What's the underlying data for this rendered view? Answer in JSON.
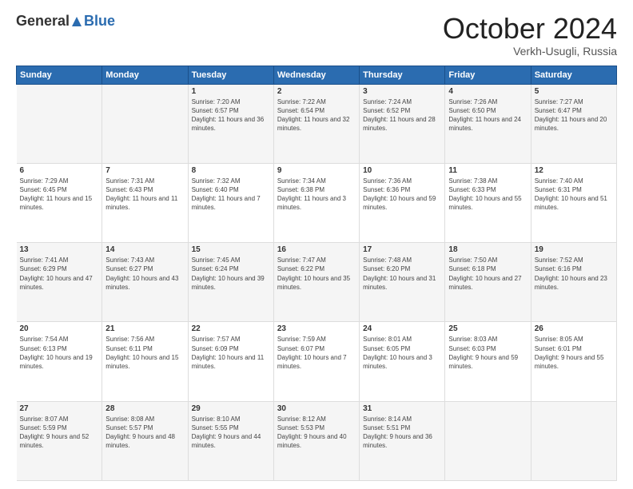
{
  "header": {
    "logo_general": "General",
    "logo_blue": "Blue",
    "month_title": "October 2024",
    "location": "Verkh-Usugli, Russia"
  },
  "days_of_week": [
    "Sunday",
    "Monday",
    "Tuesday",
    "Wednesday",
    "Thursday",
    "Friday",
    "Saturday"
  ],
  "weeks": [
    [
      {
        "day": "",
        "info": ""
      },
      {
        "day": "",
        "info": ""
      },
      {
        "day": "1",
        "info": "Sunrise: 7:20 AM\nSunset: 6:57 PM\nDaylight: 11 hours and 36 minutes."
      },
      {
        "day": "2",
        "info": "Sunrise: 7:22 AM\nSunset: 6:54 PM\nDaylight: 11 hours and 32 minutes."
      },
      {
        "day": "3",
        "info": "Sunrise: 7:24 AM\nSunset: 6:52 PM\nDaylight: 11 hours and 28 minutes."
      },
      {
        "day": "4",
        "info": "Sunrise: 7:26 AM\nSunset: 6:50 PM\nDaylight: 11 hours and 24 minutes."
      },
      {
        "day": "5",
        "info": "Sunrise: 7:27 AM\nSunset: 6:47 PM\nDaylight: 11 hours and 20 minutes."
      }
    ],
    [
      {
        "day": "6",
        "info": "Sunrise: 7:29 AM\nSunset: 6:45 PM\nDaylight: 11 hours and 15 minutes."
      },
      {
        "day": "7",
        "info": "Sunrise: 7:31 AM\nSunset: 6:43 PM\nDaylight: 11 hours and 11 minutes."
      },
      {
        "day": "8",
        "info": "Sunrise: 7:32 AM\nSunset: 6:40 PM\nDaylight: 11 hours and 7 minutes."
      },
      {
        "day": "9",
        "info": "Sunrise: 7:34 AM\nSunset: 6:38 PM\nDaylight: 11 hours and 3 minutes."
      },
      {
        "day": "10",
        "info": "Sunrise: 7:36 AM\nSunset: 6:36 PM\nDaylight: 10 hours and 59 minutes."
      },
      {
        "day": "11",
        "info": "Sunrise: 7:38 AM\nSunset: 6:33 PM\nDaylight: 10 hours and 55 minutes."
      },
      {
        "day": "12",
        "info": "Sunrise: 7:40 AM\nSunset: 6:31 PM\nDaylight: 10 hours and 51 minutes."
      }
    ],
    [
      {
        "day": "13",
        "info": "Sunrise: 7:41 AM\nSunset: 6:29 PM\nDaylight: 10 hours and 47 minutes."
      },
      {
        "day": "14",
        "info": "Sunrise: 7:43 AM\nSunset: 6:27 PM\nDaylight: 10 hours and 43 minutes."
      },
      {
        "day": "15",
        "info": "Sunrise: 7:45 AM\nSunset: 6:24 PM\nDaylight: 10 hours and 39 minutes."
      },
      {
        "day": "16",
        "info": "Sunrise: 7:47 AM\nSunset: 6:22 PM\nDaylight: 10 hours and 35 minutes."
      },
      {
        "day": "17",
        "info": "Sunrise: 7:48 AM\nSunset: 6:20 PM\nDaylight: 10 hours and 31 minutes."
      },
      {
        "day": "18",
        "info": "Sunrise: 7:50 AM\nSunset: 6:18 PM\nDaylight: 10 hours and 27 minutes."
      },
      {
        "day": "19",
        "info": "Sunrise: 7:52 AM\nSunset: 6:16 PM\nDaylight: 10 hours and 23 minutes."
      }
    ],
    [
      {
        "day": "20",
        "info": "Sunrise: 7:54 AM\nSunset: 6:13 PM\nDaylight: 10 hours and 19 minutes."
      },
      {
        "day": "21",
        "info": "Sunrise: 7:56 AM\nSunset: 6:11 PM\nDaylight: 10 hours and 15 minutes."
      },
      {
        "day": "22",
        "info": "Sunrise: 7:57 AM\nSunset: 6:09 PM\nDaylight: 10 hours and 11 minutes."
      },
      {
        "day": "23",
        "info": "Sunrise: 7:59 AM\nSunset: 6:07 PM\nDaylight: 10 hours and 7 minutes."
      },
      {
        "day": "24",
        "info": "Sunrise: 8:01 AM\nSunset: 6:05 PM\nDaylight: 10 hours and 3 minutes."
      },
      {
        "day": "25",
        "info": "Sunrise: 8:03 AM\nSunset: 6:03 PM\nDaylight: 9 hours and 59 minutes."
      },
      {
        "day": "26",
        "info": "Sunrise: 8:05 AM\nSunset: 6:01 PM\nDaylight: 9 hours and 55 minutes."
      }
    ],
    [
      {
        "day": "27",
        "info": "Sunrise: 8:07 AM\nSunset: 5:59 PM\nDaylight: 9 hours and 52 minutes."
      },
      {
        "day": "28",
        "info": "Sunrise: 8:08 AM\nSunset: 5:57 PM\nDaylight: 9 hours and 48 minutes."
      },
      {
        "day": "29",
        "info": "Sunrise: 8:10 AM\nSunset: 5:55 PM\nDaylight: 9 hours and 44 minutes."
      },
      {
        "day": "30",
        "info": "Sunrise: 8:12 AM\nSunset: 5:53 PM\nDaylight: 9 hours and 40 minutes."
      },
      {
        "day": "31",
        "info": "Sunrise: 8:14 AM\nSunset: 5:51 PM\nDaylight: 9 hours and 36 minutes."
      },
      {
        "day": "",
        "info": ""
      },
      {
        "day": "",
        "info": ""
      }
    ]
  ]
}
